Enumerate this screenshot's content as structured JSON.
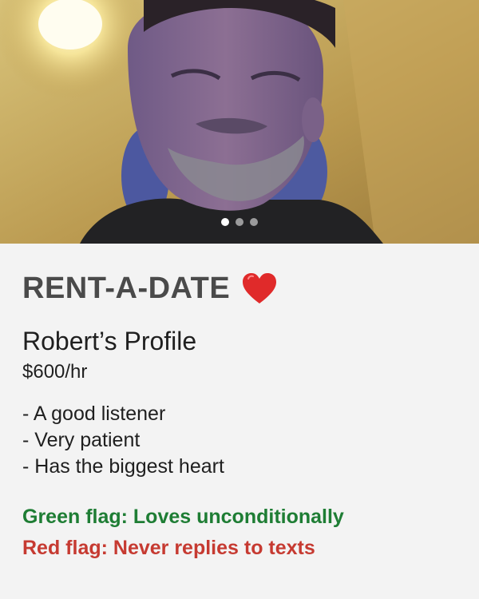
{
  "photo": {
    "alt_icon": "profile-photo",
    "carousel_count": 3,
    "carousel_active_index": 0
  },
  "brand": {
    "title": "RENT-A-DATE",
    "heart_icon": "red-heart-emoji",
    "heart_color": "#e02a2a"
  },
  "profile": {
    "name": "Robert’s Profile",
    "rate": "$600/hr",
    "traits": [
      "- A good listener",
      "- Very patient",
      "- Has the biggest heart"
    ]
  },
  "flags": {
    "green": "Green flag: Loves unconditionally",
    "green_color": "#1e7d34",
    "red": "Red flag: Never replies to texts",
    "red_color": "#c63a31"
  }
}
